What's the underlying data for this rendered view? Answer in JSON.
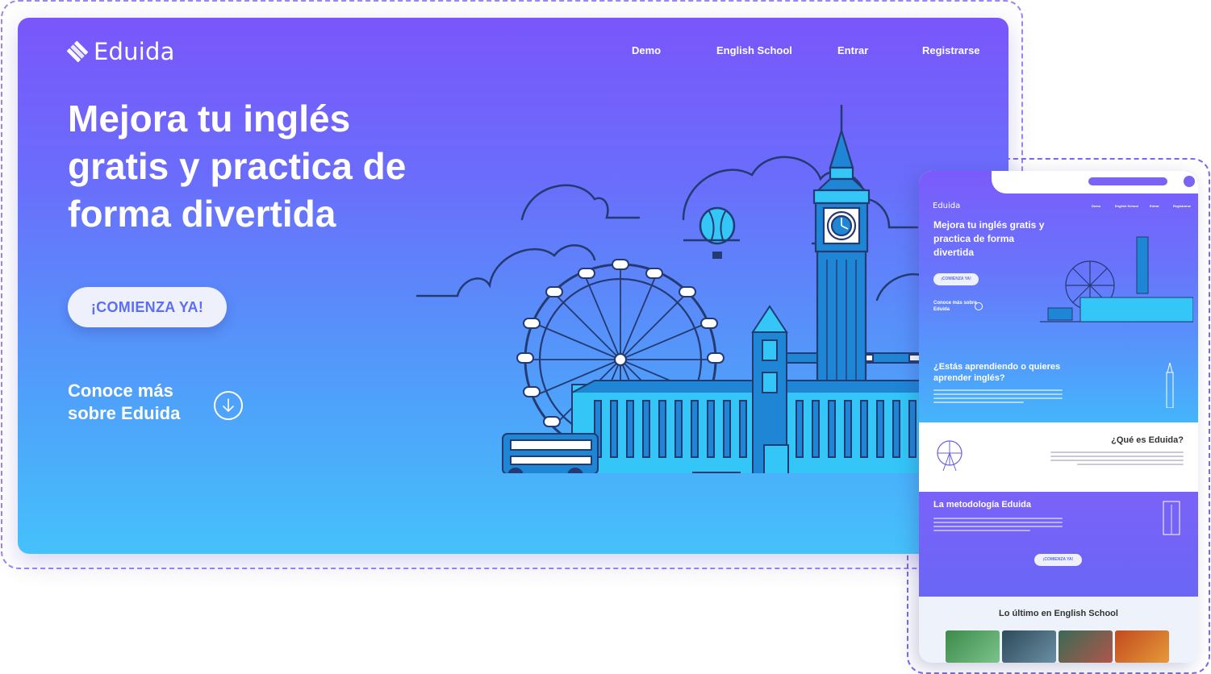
{
  "desktop": {
    "logo_text": "Eduida",
    "nav": [
      {
        "label": "Demo"
      },
      {
        "label": "English School"
      },
      {
        "label": "Entrar"
      },
      {
        "label": "Registrarse"
      }
    ],
    "hero_title": "Mejora tu inglés gratis y practica de forma divertida",
    "cta_label": "¡COMIENZA YA!",
    "more_label": "Conoce más sobre Eduida"
  },
  "mobile": {
    "logo_text": "Eduida",
    "nav": [
      {
        "label": "Demo"
      },
      {
        "label": "English School"
      },
      {
        "label": "Entrar"
      },
      {
        "label": "Registrarse"
      }
    ],
    "hero_title": "Mejora tu inglés gratis y practica de forma divertida",
    "cta_label": "¡COMIENZA YA!",
    "more_label": "Conoce más sobre Eduida",
    "question_title": "¿Estás aprendiendo o quieres aprender inglés?",
    "what_title": "¿Qué es Eduida?",
    "method_title": "La metodología Eduida",
    "cta2_label": "¡COMIENZA YA!",
    "latest_title": "Lo último en English School"
  },
  "colors": {
    "gradient_top": "#7a56fb",
    "gradient_bottom": "#45c1fb",
    "cta_text": "#5b6ef4",
    "frame_dash": "#9b87f0"
  },
  "icons": [
    "eduida-logo-icon",
    "arrow-down-circle-icon",
    "london-skyline-illustration"
  ]
}
